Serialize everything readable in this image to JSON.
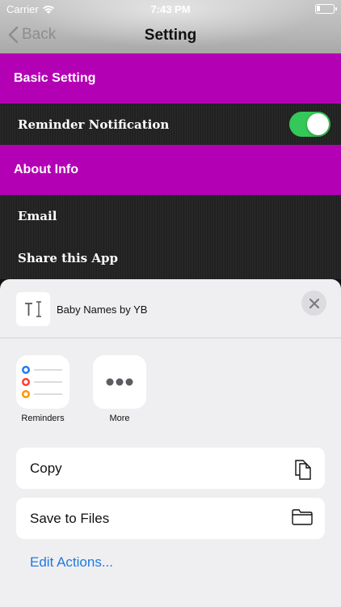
{
  "status_bar": {
    "carrier": "Carrier",
    "time": "7:43 PM"
  },
  "nav": {
    "back_label": "Back",
    "title": "Setting"
  },
  "settings": {
    "basic_section": "Basic Setting",
    "reminder_label": "Reminder Notification",
    "reminder_enabled": true,
    "about_section": "About Info",
    "email_label": "Email",
    "share_label": "Share this App"
  },
  "share_sheet": {
    "app_name": "Baby Names by YB",
    "apps": [
      {
        "label": "Reminders",
        "icon": "reminders-icon"
      },
      {
        "label": "More",
        "icon": "more-icon"
      }
    ],
    "actions": [
      {
        "label": "Copy",
        "icon": "copy-icon"
      },
      {
        "label": "Save to Files",
        "icon": "folder-icon"
      }
    ],
    "edit_actions": "Edit Actions..."
  },
  "colors": {
    "section_bg": "#b400b4",
    "toggle_on": "#34c759",
    "link": "#1f7ae0"
  }
}
